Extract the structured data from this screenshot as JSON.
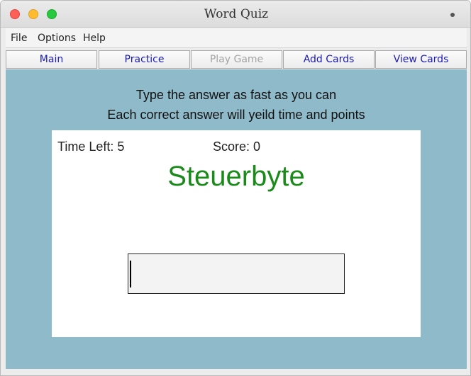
{
  "window": {
    "title": "Word Quiz"
  },
  "menubar": {
    "items": [
      "File",
      "Options",
      "Help"
    ]
  },
  "nav": {
    "buttons": [
      {
        "label": "Main",
        "enabled": true
      },
      {
        "label": "Practice",
        "enabled": true
      },
      {
        "label": "Play Game",
        "enabled": false
      },
      {
        "label": "Add Cards",
        "enabled": true
      },
      {
        "label": "View Cards",
        "enabled": true
      }
    ]
  },
  "game": {
    "instruction_line1": "Type the answer as fast as you can",
    "instruction_line2": "Each correct answer will yeild time and points",
    "time_left": "Time Left: 5",
    "score": "Score: 0",
    "word": "Steuerbyte",
    "answer_value": ""
  },
  "colors": {
    "content_background": "#8fbac9",
    "word_color": "#1a8a1a",
    "nav_text": "#1a1ab8",
    "nav_disabled_text": "#a4a4a4"
  }
}
